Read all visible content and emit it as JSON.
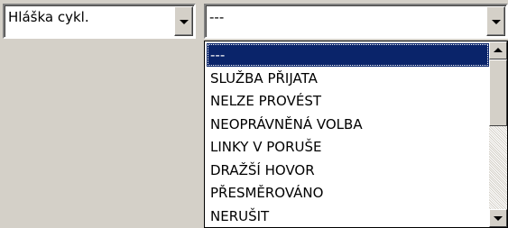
{
  "combo_left": {
    "value": "Hláška cykl."
  },
  "combo_right": {
    "value": "---"
  },
  "dropdown": {
    "items": [
      "---",
      "SLUŽBA PŘIJATA",
      "NELZE PROVÉST",
      "NEOPRÁVNĚNÁ VOLBA",
      "LINKY V PORUŠE",
      "DRAŽŠÍ HOVOR",
      "PŘESMĚROVÁNO",
      "NERUŠIT"
    ],
    "selected_index": 0
  },
  "colors": {
    "selection": "#0a246a",
    "face": "#d4d0c8"
  }
}
